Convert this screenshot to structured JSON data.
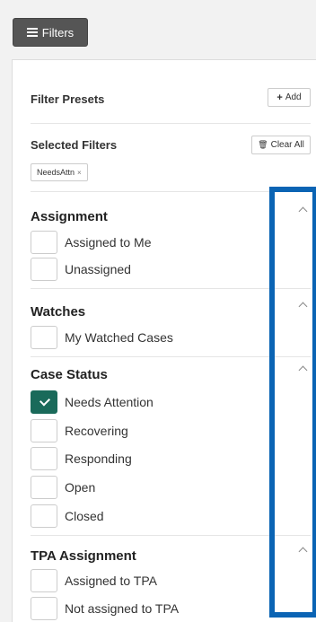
{
  "toolbar": {
    "filters_label": "Filters"
  },
  "presets": {
    "title": "Filter Presets",
    "add_label": "Add"
  },
  "selected": {
    "title": "Selected Filters",
    "clear_label": "Clear All",
    "tags": [
      "NeedsAttn"
    ]
  },
  "sections": [
    {
      "title": "Assignment",
      "options": [
        {
          "label": "Assigned to Me",
          "checked": false
        },
        {
          "label": "Unassigned",
          "checked": false
        }
      ]
    },
    {
      "title": "Watches",
      "options": [
        {
          "label": "My Watched Cases",
          "checked": false
        }
      ]
    },
    {
      "title": "Case Status",
      "options": [
        {
          "label": "Needs Attention",
          "checked": true
        },
        {
          "label": "Recovering",
          "checked": false
        },
        {
          "label": "Responding",
          "checked": false
        },
        {
          "label": "Open",
          "checked": false
        },
        {
          "label": "Closed",
          "checked": false
        }
      ]
    },
    {
      "title": "TPA Assignment",
      "options": [
        {
          "label": "Assigned to TPA",
          "checked": false
        },
        {
          "label": "Not assigned to TPA",
          "checked": false
        }
      ]
    }
  ],
  "colors": {
    "checked": "#1a6a5a",
    "highlight_frame": "#0b64b4",
    "button_dark": "#555555"
  }
}
